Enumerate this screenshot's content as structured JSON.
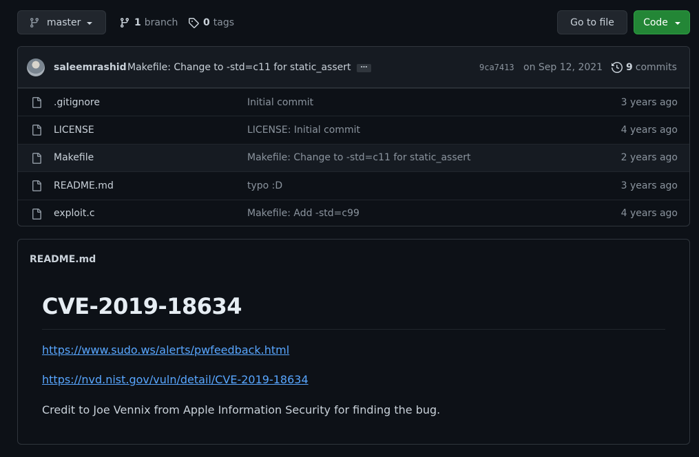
{
  "toolbar": {
    "branch_name": "master",
    "branch_count": "1",
    "branch_label": "branch",
    "tag_count": "0",
    "tag_label": "tags",
    "go_to_file": "Go to file",
    "code": "Code"
  },
  "commit": {
    "author": "saleemrashid",
    "message": "Makefile: Change to -std=c11 for static_assert",
    "ellipsis": "…",
    "sha": "9ca7413",
    "date": "on Sep 12, 2021",
    "commit_count": "9",
    "commit_label": "commits"
  },
  "files": [
    {
      "name": ".gitignore",
      "message": "Initial commit",
      "age": "3 years ago"
    },
    {
      "name": "LICENSE",
      "message": "LICENSE: Initial commit",
      "age": "4 years ago"
    },
    {
      "name": "Makefile",
      "message": "Makefile: Change to -std=c11 for static_assert",
      "age": "2 years ago"
    },
    {
      "name": "README.md",
      "message": "typo :D",
      "age": "3 years ago"
    },
    {
      "name": "exploit.c",
      "message": "Makefile: Add -std=c99",
      "age": "4 years ago"
    }
  ],
  "readme": {
    "file_label": "README.md",
    "heading": "CVE-2019-18634",
    "link1": "https://www.sudo.ws/alerts/pwfeedback.html",
    "link2": "https://nvd.nist.gov/vuln/detail/CVE-2019-18634",
    "credit": "Credit to Joe Vennix from Apple Information Security for finding the bug."
  },
  "colors": {
    "background": "#0d1117",
    "accent_link": "#58a6ff",
    "code_button": "#238636"
  },
  "icons": [
    "git-branch-icon",
    "tag-icon",
    "history-icon",
    "file-icon"
  ]
}
